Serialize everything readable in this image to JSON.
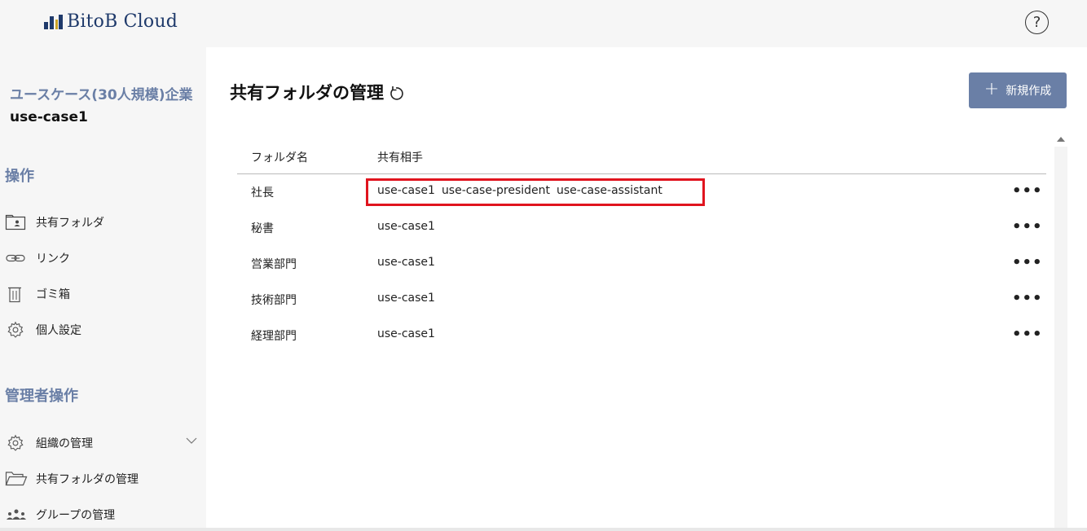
{
  "header": {
    "logo_text": "BitoB Cloud",
    "help_label": "?"
  },
  "sidebar": {
    "company_name": "ユースケース(30人規模)企業",
    "tenant_id": "use-case1",
    "sections": {
      "ops": "操作",
      "admin": "管理者操作"
    },
    "items": [
      {
        "label": "共有フォルダ",
        "icon": "folder-user-icon"
      },
      {
        "label": "リンク",
        "icon": "link-icon"
      },
      {
        "label": "ゴミ箱",
        "icon": "trash-icon"
      },
      {
        "label": "個人設定",
        "icon": "gear-icon"
      }
    ],
    "admin_items": [
      {
        "label": "組織の管理",
        "icon": "gear-icon"
      },
      {
        "label": "共有フォルダの管理",
        "icon": "folder-open-icon"
      },
      {
        "label": "グループの管理",
        "icon": "group-icon"
      }
    ]
  },
  "main": {
    "title": "共有フォルダの管理",
    "new_button_label": "新規作成",
    "new_button_icon": "+",
    "columns": {
      "name": "フォルダ名",
      "shared": "共有相手"
    },
    "rows": [
      {
        "name": "社長",
        "shared": [
          "use-case1",
          "use-case-president",
          "use-case-assistant"
        ]
      },
      {
        "name": "秘書",
        "shared": [
          "use-case1"
        ]
      },
      {
        "name": "営業部門",
        "shared": [
          "use-case1"
        ]
      },
      {
        "name": "技術部門",
        "shared": [
          "use-case1"
        ]
      },
      {
        "name": "経理部門",
        "shared": [
          "use-case1"
        ]
      }
    ],
    "more_label": "•••"
  },
  "colors": {
    "accent": "#6a7fa6",
    "brand": "#1f3a6b",
    "highlight": "#e0141e"
  }
}
